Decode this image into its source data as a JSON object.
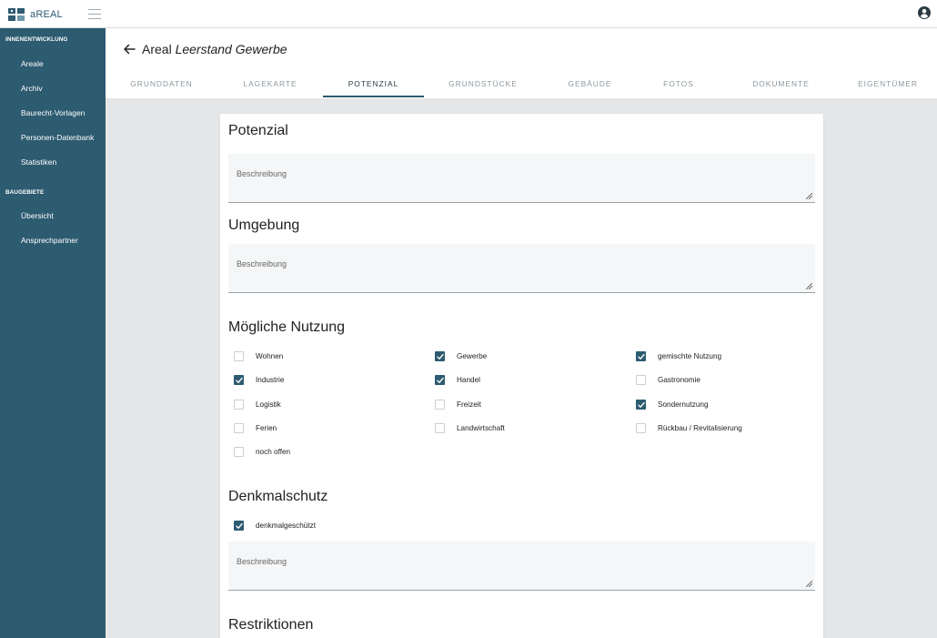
{
  "app": {
    "name": "aREAL"
  },
  "sidebar": {
    "sections": [
      {
        "title": "INNENENTWICKLUNG",
        "items": [
          "Areale",
          "Archiv",
          "Baurecht-Vorlagen",
          "Personen-Datenbank",
          "Statistiken"
        ]
      },
      {
        "title": "BAUGEBIETE",
        "items": [
          "Übersicht",
          "Ansprechpartner"
        ]
      }
    ]
  },
  "header": {
    "title_prefix": "Areal",
    "title_name": "Leerstand Gewerbe"
  },
  "tabs": [
    "GRUNDDATEN",
    "LAGEKARTE",
    "POTENZIAL",
    "GRUNDSTÜCKE",
    "GEBÄUDE",
    "FOTOS",
    "DOKUMENTE",
    "EIGENTÜMER"
  ],
  "active_tab": "POTENZIAL",
  "potenzial": {
    "heading": "Potenzial",
    "placeholder": "Beschreibung"
  },
  "umgebung": {
    "heading": "Umgebung",
    "placeholder": "Beschreibung"
  },
  "nutzung": {
    "heading": "Mögliche Nutzung",
    "options": [
      {
        "label": "Wohnen",
        "checked": false
      },
      {
        "label": "Gewerbe",
        "checked": true
      },
      {
        "label": "gemischte Nutzung",
        "checked": true
      },
      {
        "label": "Industrie",
        "checked": true
      },
      {
        "label": "Handel",
        "checked": true
      },
      {
        "label": "Gastronomie",
        "checked": false
      },
      {
        "label": "Logistik",
        "checked": false
      },
      {
        "label": "Freizeit",
        "checked": false
      },
      {
        "label": "Sondernutzung",
        "checked": true
      },
      {
        "label": "Ferien",
        "checked": false
      },
      {
        "label": "Landwirtschaft",
        "checked": false
      },
      {
        "label": "Rückbau / Revitalisierung",
        "checked": false
      },
      {
        "label": "noch offen",
        "checked": false
      }
    ]
  },
  "denkmalschutz": {
    "heading": "Denkmalschutz",
    "checkbox": {
      "label": "denkmalgeschützt",
      "checked": true
    },
    "placeholder": "Beschreibung"
  },
  "restriktionen": {
    "heading": "Restriktionen"
  },
  "colors": {
    "sidebar": "#2d5b70",
    "accent": "#2d5b70",
    "background": "#e5e6e8"
  },
  "icons": {
    "logo": "areal-logo-icon",
    "menu": "hamburger-menu-icon",
    "account": "account-circle-icon",
    "back": "arrow-left-icon",
    "checkmark": "check-icon",
    "resize": "resize-grip-icon"
  }
}
